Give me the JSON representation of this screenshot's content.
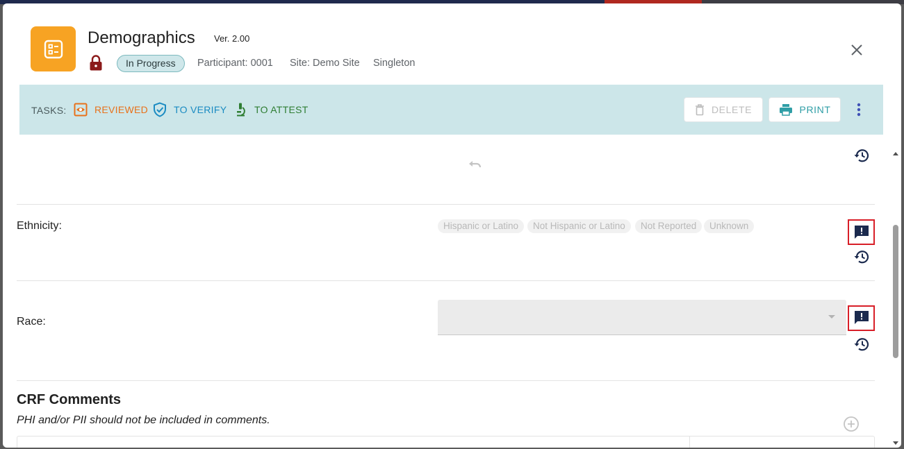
{
  "form": {
    "title": "Demographics",
    "version": "Ver. 2.00",
    "status": "In Progress",
    "participant": "Participant: 0001",
    "site": "Site: Demo Site",
    "arm": "Singleton"
  },
  "tasks": {
    "label": "TASKS:",
    "items": [
      {
        "label": "REVIEWED",
        "color": "#e8711a",
        "icon": "review-eye-icon"
      },
      {
        "label": "TO VERIFY",
        "color": "#1a8bc2",
        "icon": "verify-shield-icon"
      },
      {
        "label": "TO ATTEST",
        "color": "#2e7d32",
        "icon": "attest-microscope-icon"
      }
    ],
    "delete_label": "DELETE",
    "print_label": "PRINT"
  },
  "fields": {
    "ethnicity": {
      "label": "Ethnicity:",
      "options": [
        "Hispanic or Latino",
        "Not Hispanic or Latino",
        "Not Reported",
        "Unknown"
      ]
    },
    "race": {
      "label": "Race:",
      "value": ""
    }
  },
  "comments": {
    "title": "CRF Comments",
    "note": "PHI and/or PII should not be included in comments."
  },
  "colors": {
    "accent": "#f7a323",
    "taskbar": "#cce6e9",
    "query_highlight": "#d81e27",
    "icon_navy": "#1b2a4e"
  }
}
